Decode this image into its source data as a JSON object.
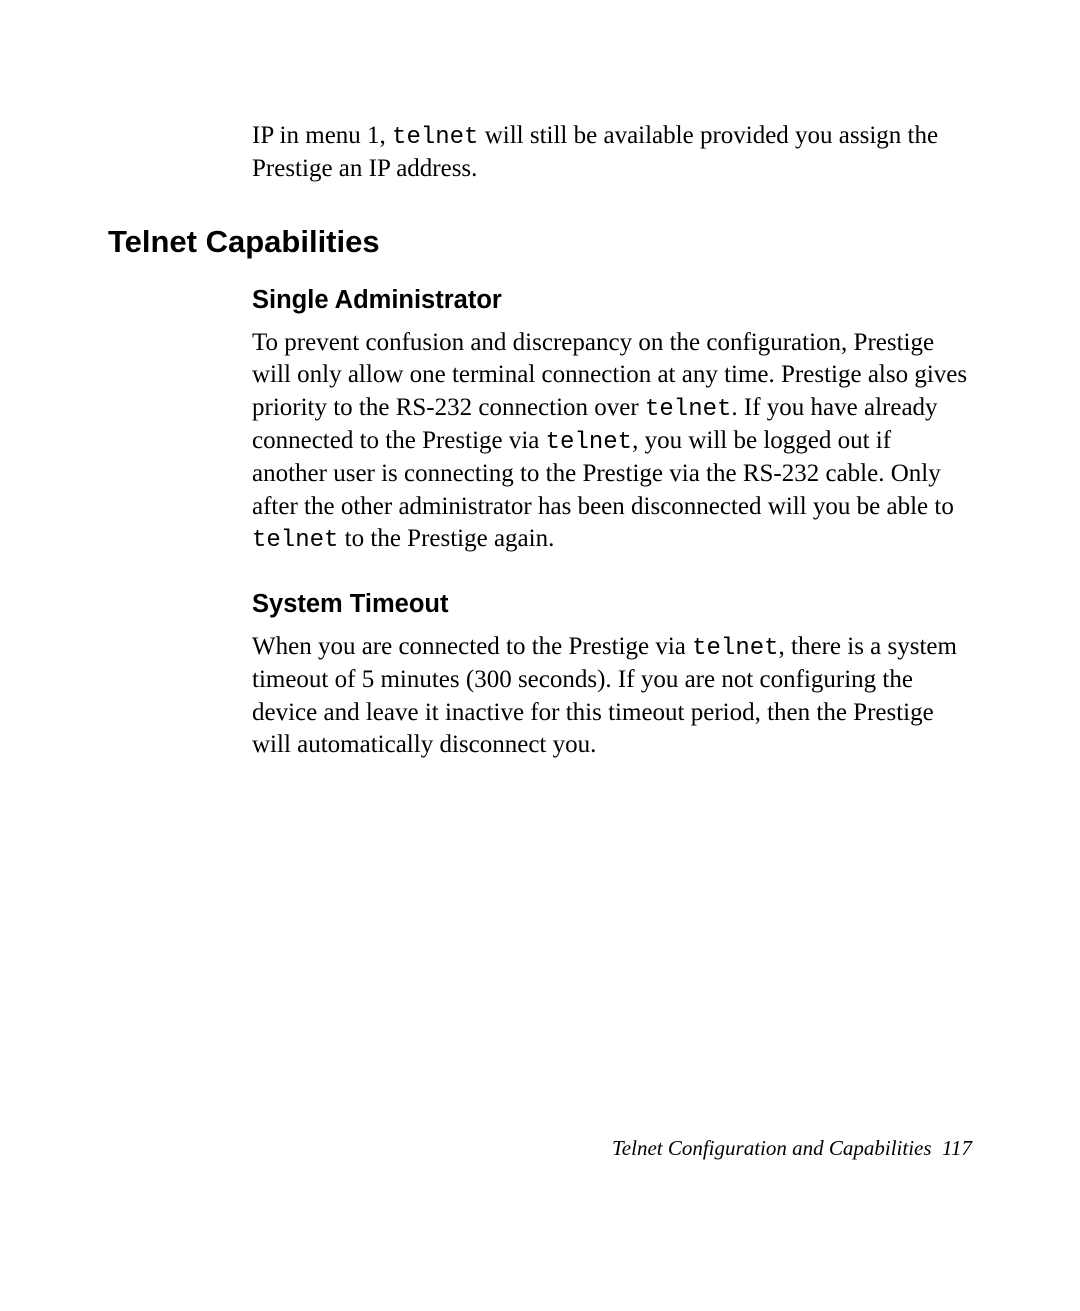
{
  "intro": {
    "pre1": "IP in menu 1, ",
    "mono1": "telnet",
    "post1": " will still be available provided you assign the Prestige an IP address."
  },
  "heading": "Telnet Capabilities",
  "single_admin": {
    "title": "Single Administrator",
    "s1": "To prevent confusion and discrepancy on the configuration, Prestige will only allow one terminal connection at any time. Prestige also gives priority to the RS-232 connection over ",
    "m1": "telnet",
    "s2": ". If you have already connected to the Prestige via ",
    "m2": "telnet",
    "s3": ", you will be logged out if another user is connecting to the Prestige via the RS-232 cable. Only after the other administrator has been disconnected will you be able to ",
    "m3": "telnet",
    "s4": " to the Prestige again."
  },
  "system_timeout": {
    "title": "System Timeout",
    "s1": "When you are connected to the Prestige via ",
    "m1": "telnet",
    "s2": ", there is a system timeout of 5 minutes (300 seconds). If you are not configuring the device and leave it inactive for this timeout period, then the Prestige will automatically disconnect you."
  },
  "footer": {
    "title": "Telnet Configuration and Capabilities",
    "page": "117"
  }
}
